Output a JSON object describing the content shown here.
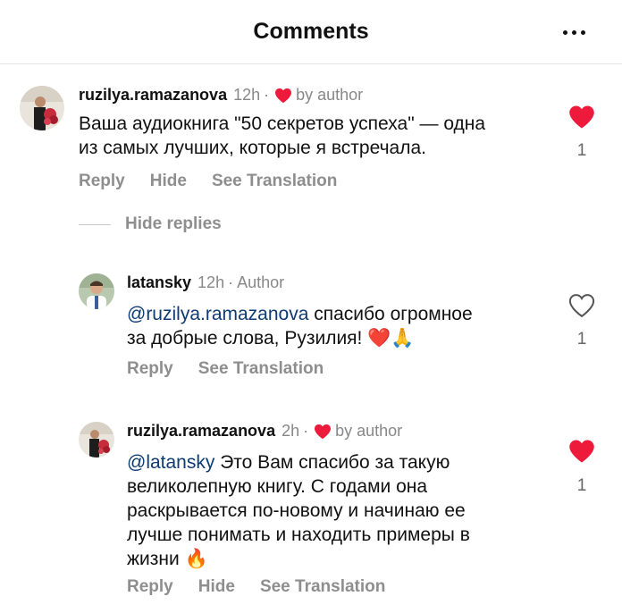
{
  "header": {
    "title": "Comments"
  },
  "comments": [
    {
      "username": "ruzilya.ramazanova",
      "time": "12h",
      "by_author": "by author",
      "text_lines": [
        "Ваша аудиокнига \"50 секретов успеха\" — одна",
        "из самых лучших, которые я встречала."
      ],
      "actions": [
        "Reply",
        "Hide",
        "See Translation"
      ],
      "likes": "1",
      "liked": true
    },
    {
      "username": "latansky",
      "time": "12h",
      "badge": "Author",
      "mention": "@ruzilya.ramazanova",
      "text_after_mention": " спасибо огромное",
      "text_line2": "за добрые слова, Рузилия!",
      "emoji": "❤️🙏",
      "actions": [
        "Reply",
        "See Translation"
      ],
      "likes": "1",
      "liked": false
    },
    {
      "username": "ruzilya.ramazanova",
      "time": "2h",
      "by_author": "by author",
      "mention": "@latansky",
      "text_after_mention": " Это Вам спасибо за такую",
      "text_lines": [
        "великолепную книгу. С годами она",
        "раскрывается по-новому и начинаю ее",
        "лучше понимать и находить примеры в",
        "жизни"
      ],
      "emoji": "🔥",
      "actions": [
        "Reply",
        "Hide",
        "See Translation"
      ],
      "likes": "1",
      "liked": true
    }
  ],
  "hide_replies_label": "Hide replies",
  "colors": {
    "heart_red": "#ed1a3b",
    "mention_blue": "#0e3b70",
    "muted_gray": "#8e8e8e"
  },
  "icons": {
    "more": "more-horizontal-icon",
    "heart_filled": "heart-filled-icon",
    "heart_outline": "heart-outline-icon"
  }
}
